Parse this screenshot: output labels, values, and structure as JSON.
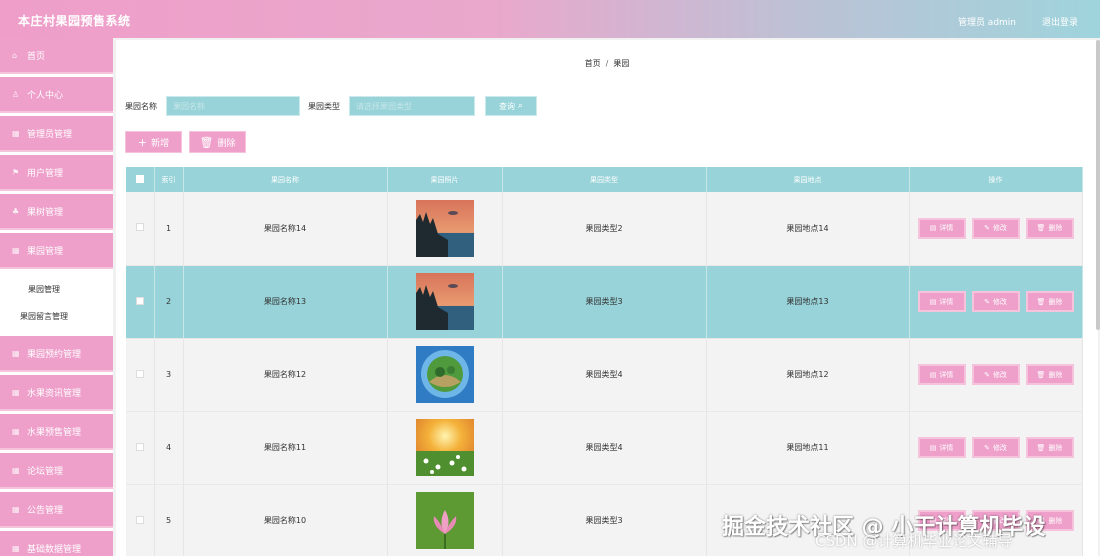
{
  "header": {
    "title": "本庄村果园预售系统",
    "user": "管理员 admin",
    "logout": "退出登录"
  },
  "sidebar": {
    "items": [
      {
        "label": "首页",
        "icon": "home-icon"
      },
      {
        "label": "个人中心",
        "icon": "user-icon"
      },
      {
        "label": "管理员管理",
        "icon": "grid-icon"
      },
      {
        "label": "用户管理",
        "icon": "flag-icon"
      },
      {
        "label": "果树管理",
        "icon": "tree-icon"
      },
      {
        "label": "果园管理",
        "icon": "grid-icon"
      }
    ],
    "submenu": [
      "果园管理",
      "果园留言管理"
    ],
    "items_after": [
      {
        "label": "果园预约管理",
        "icon": "grid-icon"
      },
      {
        "label": "水果资讯管理",
        "icon": "grid-icon"
      },
      {
        "label": "水果预售管理",
        "icon": "grid-icon"
      },
      {
        "label": "论坛管理",
        "icon": "grid-icon"
      },
      {
        "label": "公告管理",
        "icon": "grid-icon"
      },
      {
        "label": "基础数据管理",
        "icon": "grid-icon"
      }
    ]
  },
  "breadcrumb": {
    "home": "首页",
    "sep": "/",
    "current": "果园"
  },
  "search": {
    "name_label": "果园名称",
    "name_placeholder": "果园名称",
    "type_label": "果园类型",
    "type_placeholder": "请选择果园类型",
    "query_label": "查询"
  },
  "actions": {
    "add_label": "新增",
    "delete_label": "删除"
  },
  "table": {
    "headers": [
      "",
      "索引",
      "果园名称",
      "果园照片",
      "果园类型",
      "果园地点",
      "操作"
    ],
    "rows": [
      {
        "index": "1",
        "name": "果园名称14",
        "type": "果园类型2",
        "location": "果园地点14",
        "image": "lake-sunset"
      },
      {
        "index": "2",
        "name": "果园名称13",
        "type": "果园类型3",
        "location": "果园地点13",
        "image": "lake-sunset"
      },
      {
        "index": "3",
        "name": "果园名称12",
        "type": "果园类型4",
        "location": "果园地点12",
        "image": "sphere-planet"
      },
      {
        "index": "4",
        "name": "果园名称11",
        "type": "果园类型4",
        "location": "果园地点11",
        "image": "flower-field"
      },
      {
        "index": "5",
        "name": "果园名称10",
        "type": "果园类型3",
        "location": "",
        "image": "lotus"
      }
    ],
    "ops": {
      "detail": "详情",
      "edit": "修改",
      "delete": "删除"
    }
  },
  "watermark": {
    "main": "掘金技术社区 @ 小干计算机毕设",
    "sub": "CSDN @计算机毕业论文辅导"
  },
  "colors": {
    "pink": "#ee9fca",
    "teal": "#97d3d8"
  }
}
